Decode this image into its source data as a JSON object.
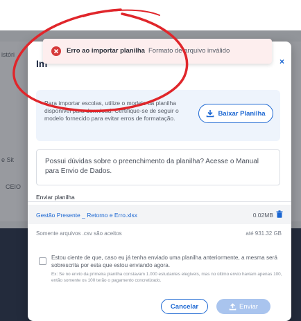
{
  "background": {
    "fragment_top": "istóri",
    "fragment_mid": "e Sit",
    "fragment_row": "CEIO"
  },
  "modal": {
    "title": "Im",
    "close_glyph": "×",
    "info_text": "Para importar escolas, utilize o modelo da planilha disponível para download. Certifique-se de seguir o modelo fornecido para evitar erros de formatação.",
    "download_label": "Baixar Planilha",
    "help_text": "Possui dúvidas sobre o preenchimento da planilha? Acesse o Manual para Envio de Dados.",
    "upload_label": "Enviar planilha",
    "file": {
      "name": "Gestão Presente _ Retorno e Erro.xlsx",
      "size": "0.02MB"
    },
    "hint_left": "Somente arquivos .csv são aceitos",
    "hint_right": "até 931.32 GB",
    "consent": "Estou ciente de que, caso eu já tenha enviado uma planilha anteriormente, a mesma será sobrescrita por esta que estou enviando agora.",
    "consent_note": "Ex: Se no envio da primeira planilha constavam 1.000 estudantes elegíveis, mas no último envio haviam apenas 100, então somente os 100 terão o pagamento concretizado.",
    "cancel_label": "Cancelar",
    "send_label": "Enviar"
  },
  "toast": {
    "title": "Erro ao importar planilha",
    "message": "Formato de arquivo inválido"
  },
  "icons": {
    "download": "download-icon",
    "trash": "trash-icon",
    "upload": "upload-icon",
    "error": "error-icon"
  },
  "colors": {
    "primary": "#1a66d2",
    "error": "#d63a3a",
    "annotation": "#e0262b",
    "send_disabled": "#a9c4ee"
  }
}
